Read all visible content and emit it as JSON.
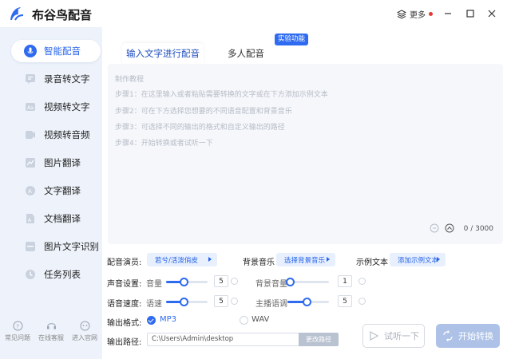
{
  "app": {
    "title": "布谷鸟配音",
    "more_label": "更多"
  },
  "sidebar": {
    "items": [
      {
        "label": "智能配音",
        "icon": "ai-voice-icon"
      },
      {
        "label": "录音转文字",
        "icon": "recording-text-icon"
      },
      {
        "label": "视频转文字",
        "icon": "video-text-icon"
      },
      {
        "label": "视频转音频",
        "icon": "video-audio-icon"
      },
      {
        "label": "图片翻译",
        "icon": "image-translate-icon"
      },
      {
        "label": "文字翻译",
        "icon": "text-translate-icon"
      },
      {
        "label": "文档翻译",
        "icon": "document-translate-icon"
      },
      {
        "label": "图片文字识别",
        "icon": "image-ocr-icon"
      },
      {
        "label": "任务列表",
        "icon": "task-list-icon"
      }
    ],
    "footer": [
      {
        "label": "常见问题",
        "icon": "question-icon"
      },
      {
        "label": "在线客服",
        "icon": "headset-icon"
      },
      {
        "label": "进入官网",
        "icon": "website-icon"
      }
    ]
  },
  "tabs": {
    "active": "输入文字进行配音",
    "inactive": "多人配音",
    "badge": "实验功能"
  },
  "editor": {
    "hints": [
      "制作教程",
      "步骤1：在这里输入或者粘贴需要转换的文字或在下方添加示例文本",
      "步骤2：可在下方选择您想要的不同语音配置和背景音乐",
      "步骤3：可选择不同的输出的格式和自定义输出的路径",
      "步骤4：开始转换或者试听一下"
    ],
    "char_count": "0 / 3000"
  },
  "settings": {
    "voice_label": "配音演员:",
    "voice_value": "若兮/活泼俏皮",
    "bgm_label": "背景音乐",
    "bgm_value": "选择背景音乐",
    "sample_label": "示例文本",
    "sample_value": "添加示例文本",
    "sound_label": "声音设置:",
    "volume_label": "音量",
    "volume_value": "5",
    "bgm_volume_label": "背景音量",
    "bgm_volume_value": "1",
    "speed_label": "语音速度:",
    "speed_sub_label": "语速",
    "speed_value": "5",
    "pitch_label": "主播语调",
    "pitch_value": "5",
    "format_label": "输出格式:",
    "format_mp3": "MP3",
    "format_wav": "WAV",
    "path_label": "输出路径:",
    "path_value": "C:\\Users\\Admin\\desktop",
    "path_button": "更改路径"
  },
  "actions": {
    "listen": "试听一下",
    "start": "开始转换"
  },
  "colors": {
    "accent": "#2f6bf0",
    "sidebar_bg": "#eef3fb"
  }
}
